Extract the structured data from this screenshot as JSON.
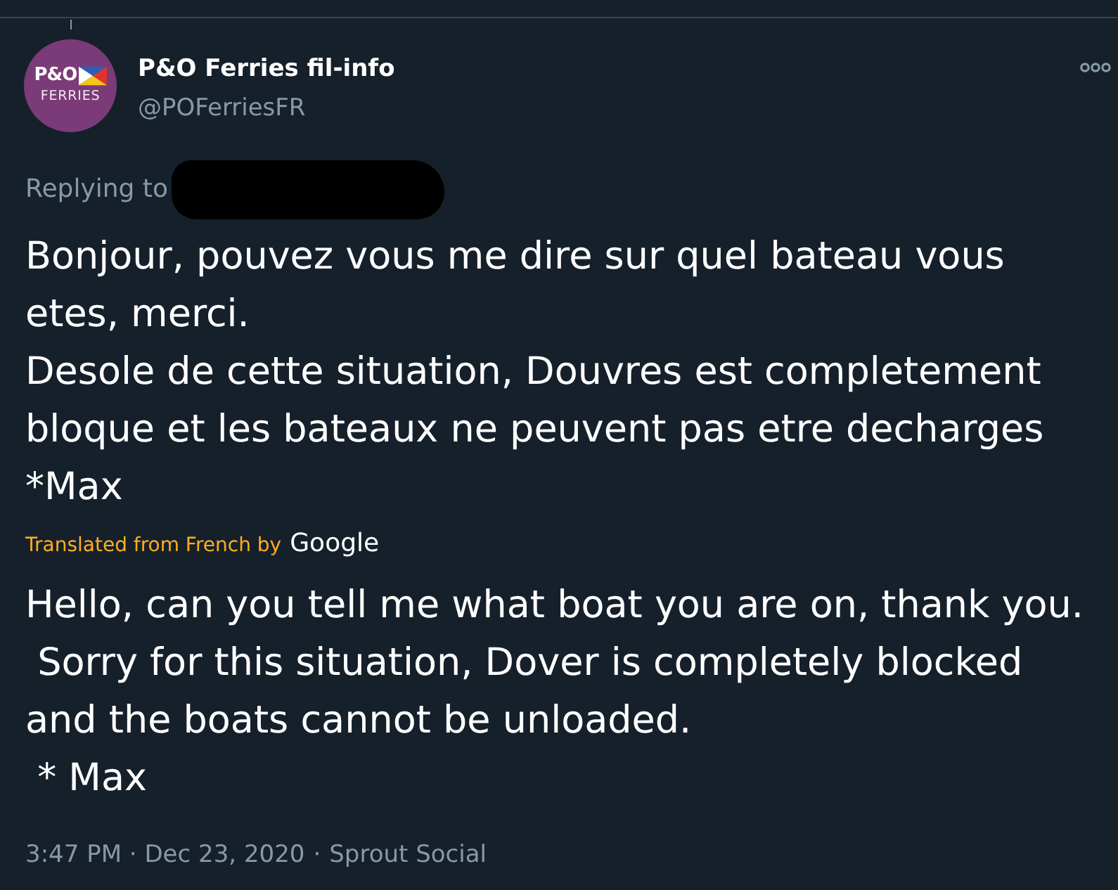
{
  "author": {
    "avatar_logo": {
      "line_1": "P&O",
      "line_2": "FERRIES"
    },
    "name": "P&O Ferries fil-info",
    "handle": "@POFerriesFR"
  },
  "reply": {
    "label": "Replying to"
  },
  "tweet": {
    "text": "Bonjour, pouvez vous me dire sur quel bateau vous\netes, merci.\nDesole de cette situation, Douvres est completement\nbloque et les bateaux ne peuvent pas etre decharges\n*Max"
  },
  "translation": {
    "label": "Translated from French by",
    "provider": "Google",
    "text": "Hello, can you tell me what boat you are on, thank you.\n Sorry for this situation, Dover is completely blocked\nand the boats cannot be unloaded.\n * Max"
  },
  "footer": {
    "timestamp": "3:47 PM · Dec 23, 2020",
    "separator": "·",
    "source": "Sprout Social"
  }
}
